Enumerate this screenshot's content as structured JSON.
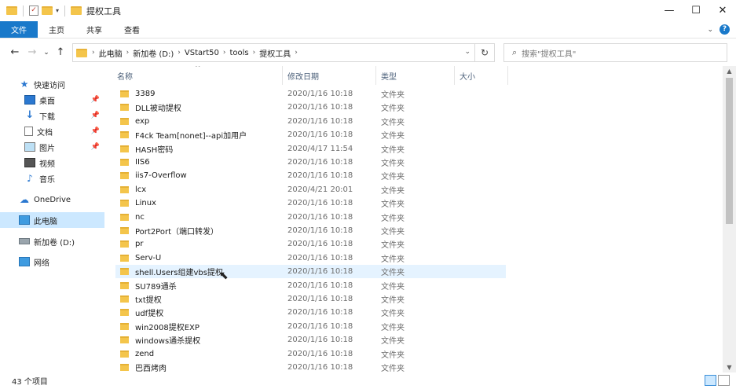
{
  "window": {
    "title": "提权工具",
    "qat_dropdown": "▾",
    "controls": {
      "minimize": "—",
      "maximize": "☐",
      "close": "✕"
    }
  },
  "ribbon": {
    "tabs": [
      "文件",
      "主页",
      "共享",
      "查看"
    ],
    "expand": "⌄",
    "help": "?"
  },
  "nav": {
    "back": "←",
    "forward": "→",
    "recent": "⌄",
    "up": "↑"
  },
  "address": {
    "crumbs": [
      "此电脑",
      "新加卷 (D:)",
      "VStart50",
      "tools",
      "提权工具"
    ],
    "separator": "›",
    "dropdown": "⌄",
    "refresh": "↻"
  },
  "search": {
    "placeholder": "搜索\"提权工具\"",
    "icon": "⌕"
  },
  "sidebar": {
    "quick_access": "快速访问",
    "items": [
      {
        "label": "桌面",
        "icon": "desktop-icon",
        "pinned": true
      },
      {
        "label": "下载",
        "icon": "download-icon",
        "pinned": true
      },
      {
        "label": "文档",
        "icon": "document-icon",
        "pinned": true
      },
      {
        "label": "图片",
        "icon": "picture-icon",
        "pinned": true
      },
      {
        "label": "视频",
        "icon": "video-icon",
        "pinned": false
      },
      {
        "label": "音乐",
        "icon": "music-icon",
        "pinned": false
      }
    ],
    "onedrive": "OneDrive",
    "this_pc": "此电脑",
    "drive": "新加卷 (D:)",
    "network": "网络",
    "pin_glyph": "📌"
  },
  "columns": {
    "name": "名称",
    "date": "修改日期",
    "type": "类型",
    "size": "大小"
  },
  "files": [
    {
      "name": "3389",
      "date": "2020/1/16 10:18",
      "type": "文件夹"
    },
    {
      "name": "DLL被动提权",
      "date": "2020/1/16 10:18",
      "type": "文件夹"
    },
    {
      "name": "exp",
      "date": "2020/1/16 10:18",
      "type": "文件夹"
    },
    {
      "name": "F4ck Team[nonet]--api加用户",
      "date": "2020/1/16 10:18",
      "type": "文件夹"
    },
    {
      "name": "HASH密码",
      "date": "2020/4/17 11:54",
      "type": "文件夹"
    },
    {
      "name": "IIS6",
      "date": "2020/1/16 10:18",
      "type": "文件夹"
    },
    {
      "name": "iis7-Overflow",
      "date": "2020/1/16 10:18",
      "type": "文件夹"
    },
    {
      "name": "lcx",
      "date": "2020/4/21 20:01",
      "type": "文件夹"
    },
    {
      "name": "Linux",
      "date": "2020/1/16 10:18",
      "type": "文件夹"
    },
    {
      "name": "nc",
      "date": "2020/1/16 10:18",
      "type": "文件夹"
    },
    {
      "name": "Port2Port（端口转发）",
      "date": "2020/1/16 10:18",
      "type": "文件夹"
    },
    {
      "name": "pr",
      "date": "2020/1/16 10:18",
      "type": "文件夹"
    },
    {
      "name": "Serv-U",
      "date": "2020/1/16 10:18",
      "type": "文件夹"
    },
    {
      "name": "shell.Users组建vbs提权",
      "date": "2020/1/16 10:18",
      "type": "文件夹"
    },
    {
      "name": "SU789通杀",
      "date": "2020/1/16 10:18",
      "type": "文件夹"
    },
    {
      "name": "txt提权",
      "date": "2020/1/16 10:18",
      "type": "文件夹"
    },
    {
      "name": "udf提权",
      "date": "2020/1/16 10:18",
      "type": "文件夹"
    },
    {
      "name": "win2008提权EXP",
      "date": "2020/1/16 10:18",
      "type": "文件夹"
    },
    {
      "name": "windows通杀提权",
      "date": "2020/1/16 10:18",
      "type": "文件夹"
    },
    {
      "name": "zend",
      "date": "2020/1/16 10:18",
      "type": "文件夹"
    },
    {
      "name": "巴西烤肉",
      "date": "2020/1/16 10:18",
      "type": "文件夹"
    }
  ],
  "hovered_file": "shell.Users组建vbs提权",
  "status": {
    "count": "43 个项目"
  },
  "colors": {
    "accent": "#1979ca",
    "folder": "#f4c54b",
    "hover": "#e5f3ff",
    "selected": "#cce8ff"
  }
}
